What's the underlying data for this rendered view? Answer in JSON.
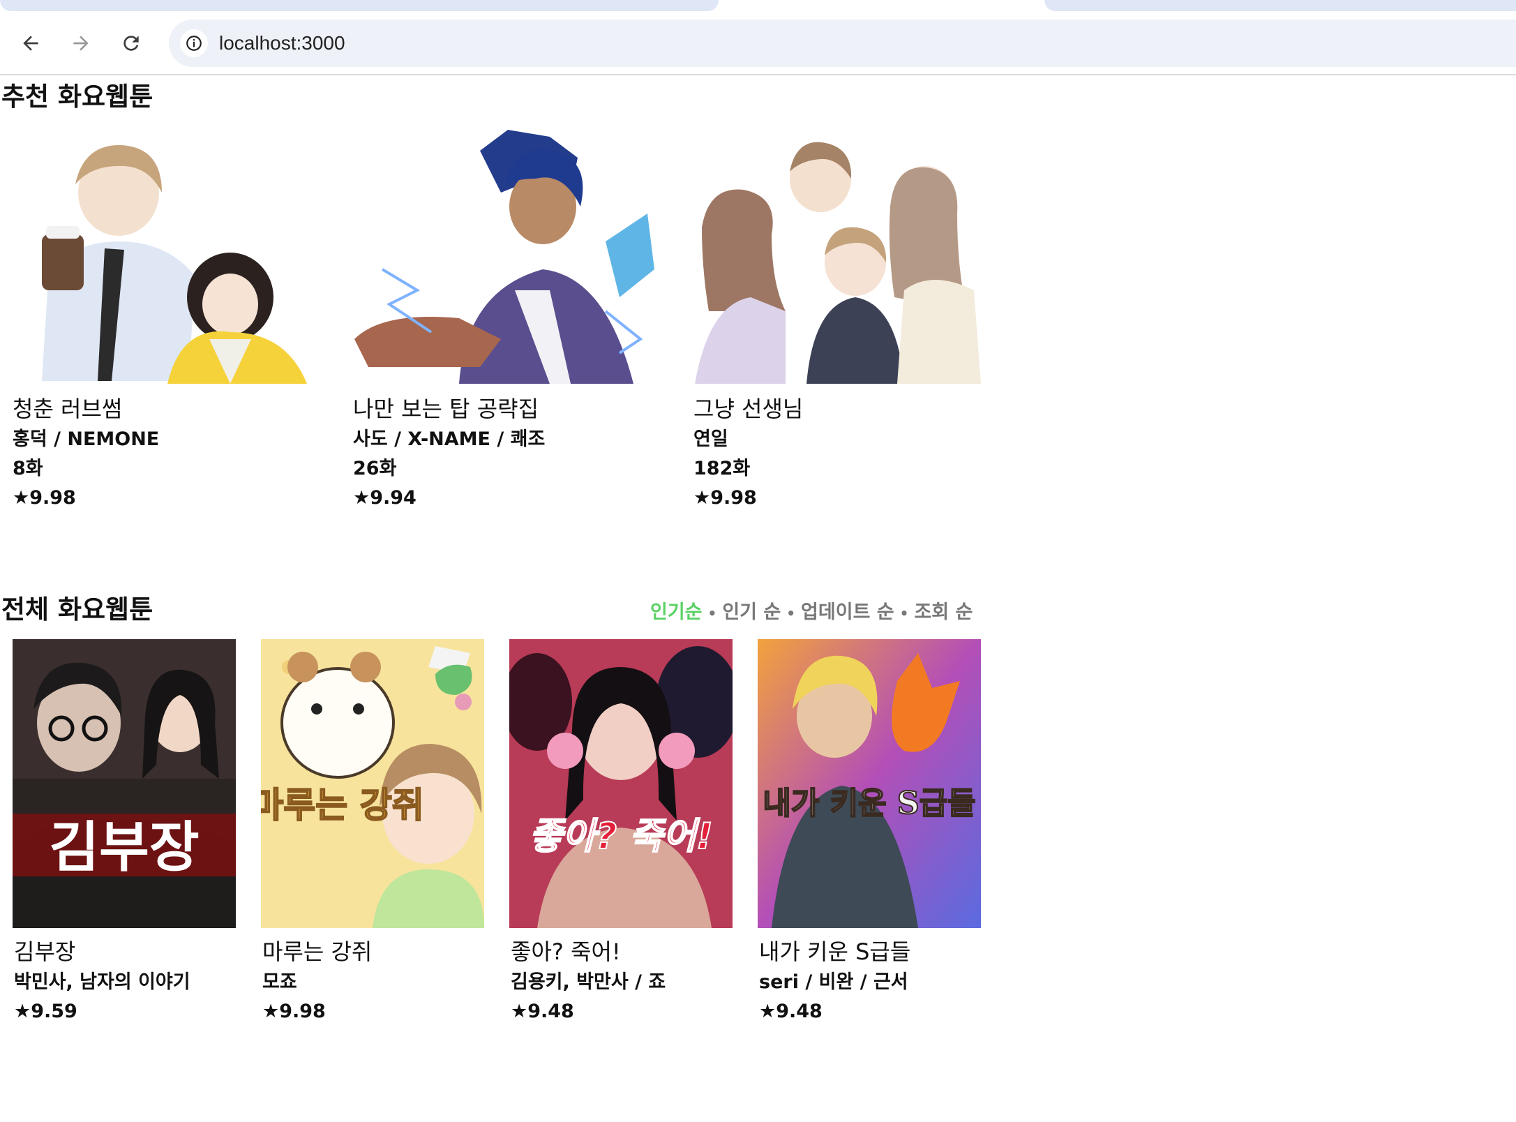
{
  "browser": {
    "url": "localhost:3000",
    "icons": [
      "back-arrow-icon",
      "forward-arrow-icon",
      "reload-icon",
      "site-info-icon"
    ]
  },
  "recommended": {
    "title": "추천 화요웹툰",
    "items": [
      {
        "title": "청춘 러브썸",
        "author": "홍덕 / NEMONE",
        "episodes": "8화",
        "rating": "★9.98"
      },
      {
        "title": "나만 보는 탑 공략집",
        "author": "사도 / X-NAME / 쾌조",
        "episodes": "26화",
        "rating": "★9.94"
      },
      {
        "title": "그냥 선생님",
        "author": "연일",
        "episodes": "182화",
        "rating": "★9.98"
      }
    ]
  },
  "all": {
    "title": "전체 화요웹툰",
    "sort_options": [
      "인기순",
      "인기 순",
      "업데이트 순",
      "조회 순"
    ],
    "sort_separator": "•",
    "active_sort": "인기순",
    "items": [
      {
        "title": "김부장",
        "author": "박민사, 남자의 이야기",
        "rating": "★9.59",
        "cover_text": "김부장"
      },
      {
        "title": "마루는 강쥐",
        "author": "모죠",
        "rating": "★9.98",
        "cover_text": "마루는 강쥐"
      },
      {
        "title": "좋아? 죽어!",
        "author": "김용키, 박만사 / 죠",
        "rating": "★9.48",
        "cover_text": "좋아? 죽어!"
      },
      {
        "title": "내가 키운 S급들",
        "author": "seri / 비완 / 근서",
        "rating": "★9.48",
        "cover_text": "내가 키운 S급들"
      }
    ]
  },
  "colors": {
    "active_sort": "#59d163",
    "inactive_sort": "#777777",
    "omnibox_bg": "#eef1f7",
    "tab_bg": "#dfe7f6"
  }
}
